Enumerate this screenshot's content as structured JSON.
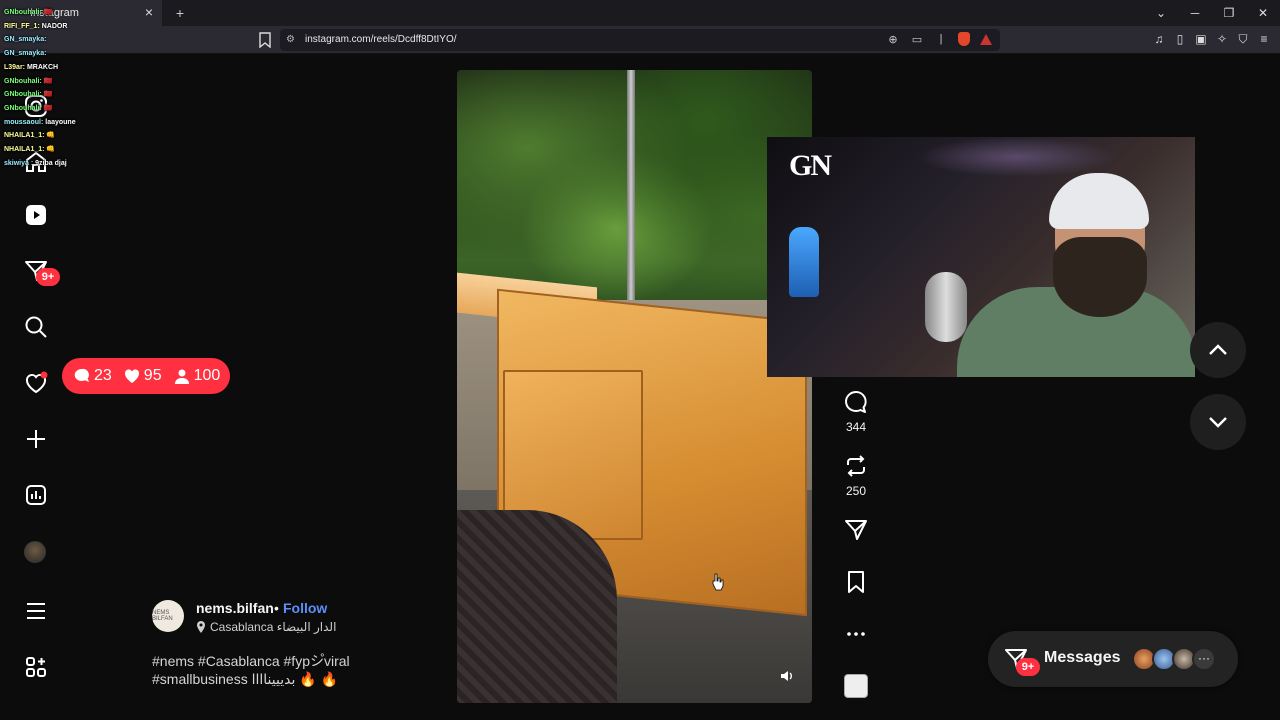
{
  "browser": {
    "tab_title": "Instagram",
    "url": "instagram.com/reels/Dcdff8DtIYO/",
    "new_tab": "+",
    "close": "×"
  },
  "chat": [
    {
      "user": "GNbouhali:",
      "msg": "🇲🇦"
    },
    {
      "user": "RIFI_FF_1:",
      "msg": "NADOR"
    },
    {
      "user": "GN_smayka:",
      "msg": ""
    },
    {
      "user": "GN_smayka:",
      "msg": ""
    },
    {
      "user": "L39ar:",
      "msg": "MRAKCH"
    },
    {
      "user": "GNbouhali:",
      "msg": "🇲🇦"
    },
    {
      "user": "GNbouhali:",
      "msg": "🇲🇦"
    },
    {
      "user": "GNbouhali:",
      "msg": "🇲🇦"
    },
    {
      "user": "moussaoul:",
      "msg": "laayoune"
    },
    {
      "user": "NHAILA1_1:",
      "msg": "👊"
    },
    {
      "user": "NHAILA1_1:",
      "msg": "👊"
    },
    {
      "user": "skiwiya :",
      "msg": "9ziba djaj"
    }
  ],
  "nav": {
    "notification_badge": "9+"
  },
  "stats": {
    "comments": "23",
    "likes": "95",
    "followers": "100"
  },
  "reel": {
    "author": "nems.bilfan",
    "separator": "•",
    "follow_label": "Follow",
    "location": "Casablanca الدار البيضاء",
    "caption_line1": "#nems #Casablanca #fypシ゚viral",
    "caption_line2": "#smallbusiness بديييناااا 🔥 🔥",
    "avatar_text": "NEMS BILFAN"
  },
  "actions": {
    "comments_count": "344",
    "reposts_count": "250"
  },
  "webcam": {
    "logo": "GN"
  },
  "messages": {
    "label": "Messages",
    "badge": "9+",
    "more": "···"
  }
}
